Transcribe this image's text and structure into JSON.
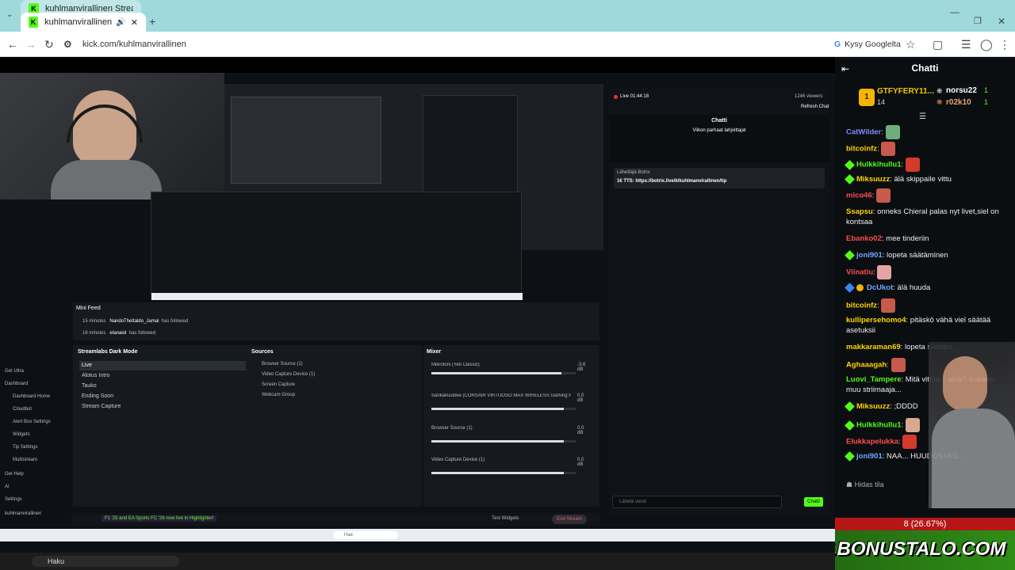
{
  "browser": {
    "tabs": [
      {
        "title": "kuhlmanvirallinen Stream"
      },
      {
        "title": "kuhlmanvirallinen Stream"
      }
    ],
    "url": "kick.com/kuhlmanvirallinen",
    "ask_google": "Kysy Googlelta"
  },
  "stream": {
    "mini_feed_title": "Mini Feed",
    "feed": [
      {
        "time": "15 minutes",
        "user": "NandoTheItaldo_Jamal",
        "action": "has followed"
      },
      {
        "time": "16 minutes",
        "user": "etanaiol",
        "action": "has followed"
      }
    ],
    "scenes_title": "Streamlabs Dark Mode",
    "scenes": [
      "Live",
      "Alotus Intro",
      "Tauko",
      "Ending Soon",
      "Stream Capture"
    ],
    "sources_title": "Sources",
    "sources": [
      "Browser Source (1)",
      "Video Capture Device (1)",
      "Screen Capture",
      "Webcam Group"
    ],
    "mixer_title": "Mixer",
    "mixer": [
      {
        "name": "Mikrofoni (Yeti Classic)",
        "db": "-3.6 dB",
        "level": 0.9
      },
      {
        "name": "Sankakuulokе (CORSAIR VIRTUOSO MAX WIRELESS Gaming Recei...",
        "db": "0.0 dB",
        "level": 0.92
      },
      {
        "name": "Browser Source (1)",
        "db": "0.0 dB",
        "level": 0.92
      },
      {
        "name": "Video Capture Device (1)",
        "db": "0.0 dB",
        "level": 0.92
      }
    ],
    "left_menu": [
      "Get Ultra",
      "Dashboard",
      "Dashboard Home",
      "Cloudbot",
      "Alert Box Settings",
      "Widgets",
      "Tip Settings",
      "Multistream",
      "Get Help",
      "AI",
      "Settings",
      "kuhlmanvirallinen"
    ],
    "ticker": "F1 '25 and EA Sports FC '26 now live in Highlighter!",
    "test_widgets": "Test Widgets",
    "end_stream": "End Stream",
    "inner_chat_title": "Chatti",
    "inner_chat_subtitle": "Viikon parhaat lahjoittajat",
    "inner_live": "Live 01:44:18",
    "inner_viewers": "1246 viewers",
    "refresh_chat": "Refresh Chat",
    "inner_input_placeholder": "Lähetä viesti",
    "inner_send": "Chatti",
    "pinned": "Lähettäjä Botrix",
    "tts": "1€ TTS: https://botrix.live/k/kuhlmanvirallinen/tip",
    "taskbar_search": "Hae",
    "os_search": "Haku"
  },
  "chat": {
    "title": "Chatti",
    "top": [
      {
        "name": "GTFYFERY11...",
        "count": "14"
      },
      {
        "name": "norsu22",
        "count": "1"
      },
      {
        "name": "r02k10",
        "count": "1"
      }
    ],
    "messages": [
      {
        "user": "CatWilder",
        "color": "#7e8cff",
        "text": ""
      },
      {
        "user": "bitcoinfz",
        "color": "#ffd400",
        "text": ""
      },
      {
        "user": "Hulkkihullu1",
        "color": "#53fc18",
        "text": ""
      },
      {
        "user": "Miksuuzz",
        "color": "#ffd400",
        "text": "älä skippaile vittu"
      },
      {
        "user": "mico46",
        "color": "#ff4d4d",
        "text": ""
      },
      {
        "user": "Ssapsu",
        "color": "#ffd400",
        "text": "onneks Chieral palas nyt livet,siel on kontsaa"
      },
      {
        "user": "Ebanko02",
        "color": "#ff4d4d",
        "text": "mee tinderiin"
      },
      {
        "user": "joni901",
        "color": "#6fa8ff",
        "text": "lopeta säätäminen"
      },
      {
        "user": "Viinatiu",
        "color": "#ff4d4d",
        "text": ""
      },
      {
        "user": "DcUkot",
        "color": "#6fa8ff",
        "text": "älä huuda"
      },
      {
        "user": "bitcoinfz",
        "color": "#ffd400",
        "text": ""
      },
      {
        "user": "kullipersehomo4",
        "color": "#ffd400",
        "text": "pitäskö vähä viel säätää asetuksii"
      },
      {
        "user": "makkaraman69",
        "color": "#ffd400",
        "text": "lopeta säätäm..."
      },
      {
        "user": "Aghaaagah",
        "color": "#ffd400",
        "text": ""
      },
      {
        "user": "Luovi_Tampere",
        "color": "#53fc18",
        "text": "Mitä vittua... aina? Kukaan muu striimaaja..."
      },
      {
        "user": "Miksuuzz",
        "color": "#ffd400",
        "text": ";DDDD"
      },
      {
        "user": "Hulkkihullu1",
        "color": "#53fc18",
        "text": ""
      },
      {
        "user": "Elukkapelukka",
        "color": "#ff4d4d",
        "text": ""
      },
      {
        "user": "joni901",
        "color": "#6fa8ff",
        "text": "NAA... HUUDOSTAS..."
      }
    ],
    "slow_mode": "Hidas tila",
    "overlay_count": "8 (26.67%)",
    "overlay_brand": "WWW.BONUSTALO.COM"
  }
}
